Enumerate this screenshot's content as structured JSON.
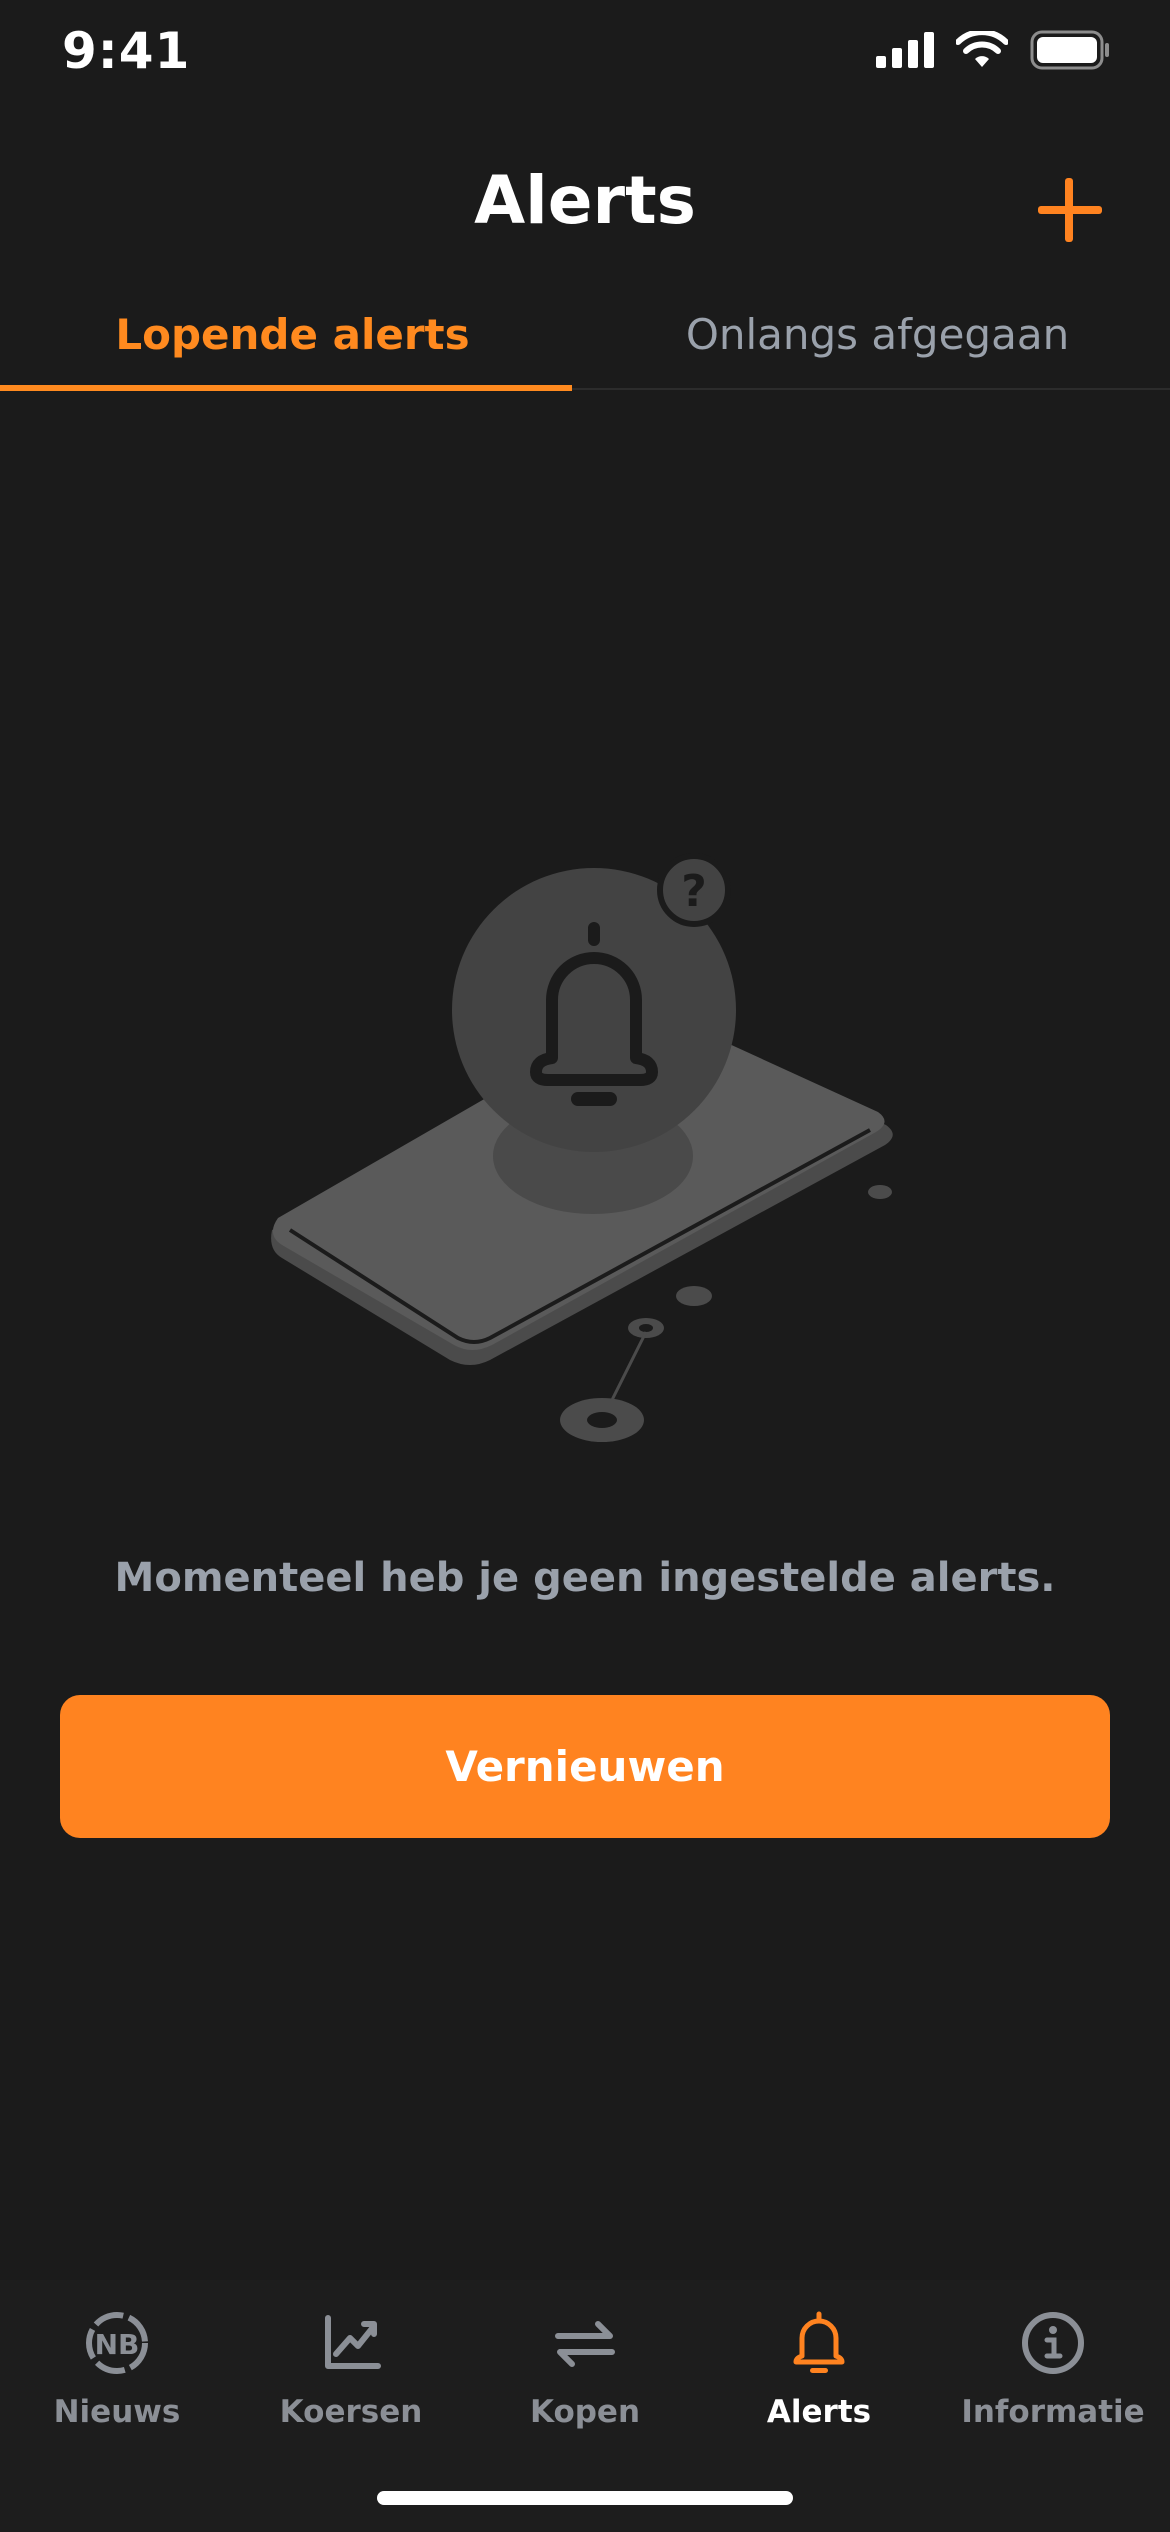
{
  "status_bar": {
    "time": "9:41",
    "icons": [
      "signal-icon",
      "wifi-icon",
      "battery-icon"
    ]
  },
  "header": {
    "title": "Alerts",
    "add_icon": "plus-icon"
  },
  "tabs": [
    {
      "label": "Lopende alerts",
      "active": true
    },
    {
      "label": "Onlangs afgegaan",
      "active": false
    }
  ],
  "empty_state": {
    "illustration": "phone-bell-question-illustration",
    "message": "Momenteel heb je geen ingestelde alerts.",
    "button_label": "Vernieuwen"
  },
  "tabbar": [
    {
      "label": "Nieuws",
      "icon": "news-coin-icon",
      "active": false
    },
    {
      "label": "Koersen",
      "icon": "chart-icon",
      "active": false
    },
    {
      "label": "Kopen",
      "icon": "swap-arrows-icon",
      "active": false
    },
    {
      "label": "Alerts",
      "icon": "bell-icon",
      "active": true
    },
    {
      "label": "Informatie",
      "icon": "info-icon",
      "active": false
    }
  ],
  "colors": {
    "accent": "#ff8320",
    "background": "#1b1b1b",
    "muted_text": "#9aa1ab"
  }
}
